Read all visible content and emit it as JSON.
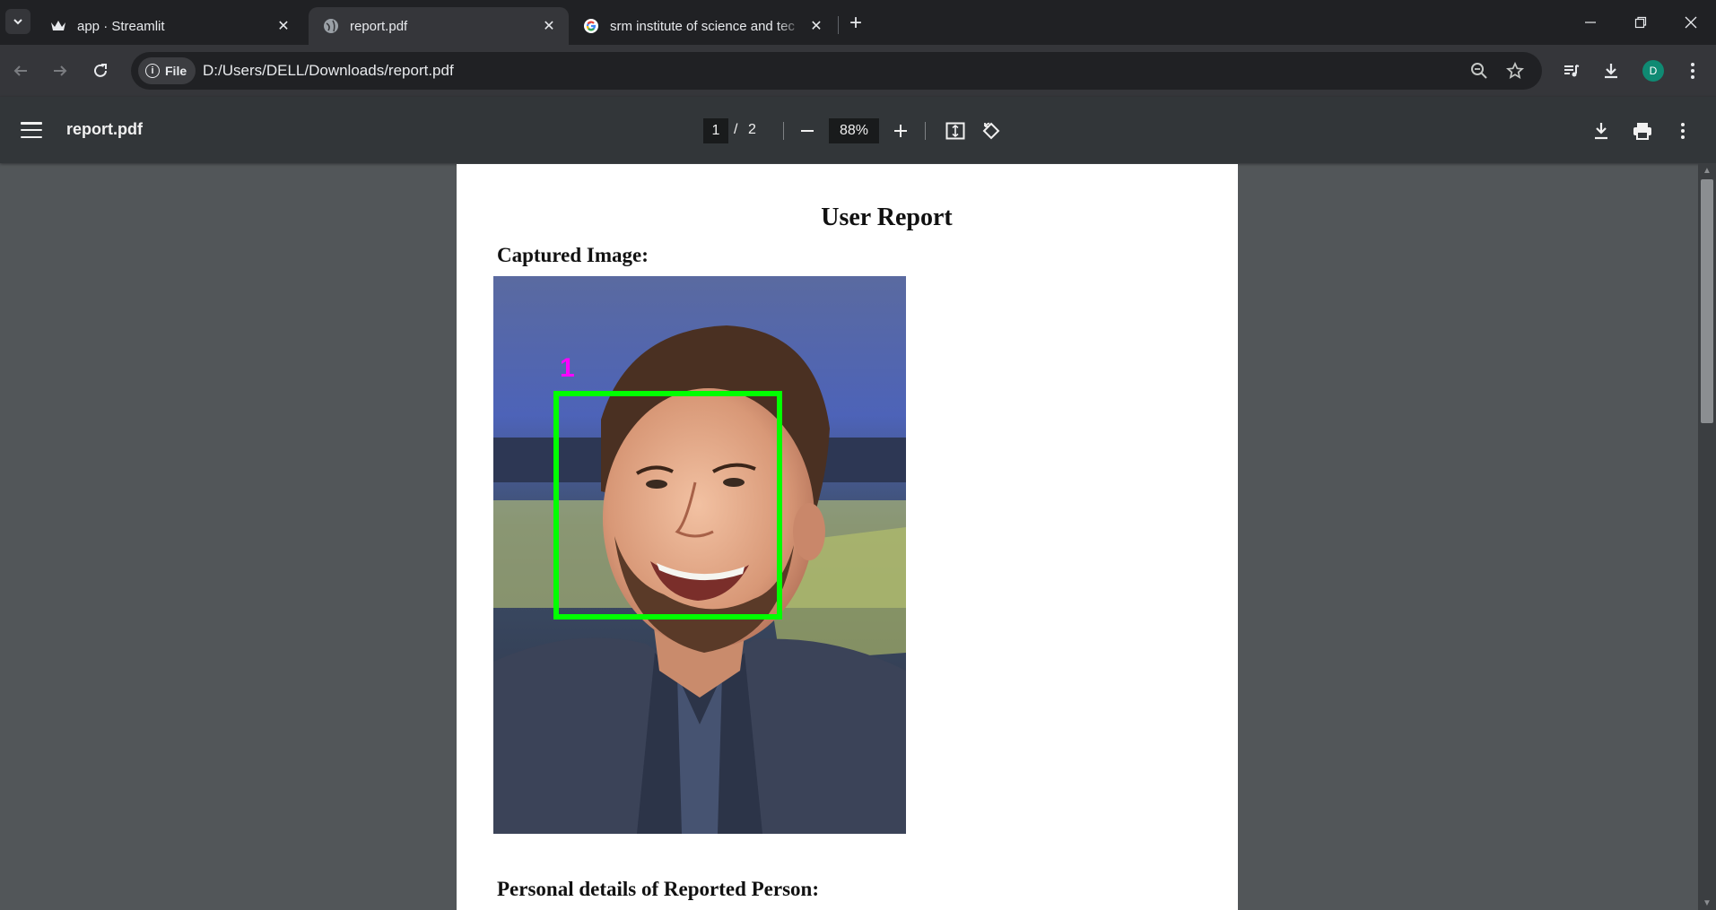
{
  "browser": {
    "tabs": [
      {
        "title": "app · Streamlit",
        "favicon": "streamlit-crown-icon",
        "active": false
      },
      {
        "title": "report.pdf",
        "favicon": "globe-icon",
        "active": true
      },
      {
        "title": "srm institute of science and tec",
        "favicon": "google-g-icon",
        "active": false
      }
    ],
    "address": {
      "chip_label": "File",
      "url": "D:/Users/DELL/Downloads/report.pdf"
    },
    "profile_initial": "D"
  },
  "pdf_viewer": {
    "file_name": "report.pdf",
    "current_page": "1",
    "page_separator": "/",
    "total_pages": "2",
    "zoom": "88%"
  },
  "document": {
    "title": "User Report",
    "captured_label": "Captured Image:",
    "face_index_label": "1",
    "details_label": "Personal details of Reported Person:"
  },
  "colors": {
    "detection_box": "#00ff00",
    "face_index": "#ff00ff",
    "avatar": "#0f8a73"
  }
}
